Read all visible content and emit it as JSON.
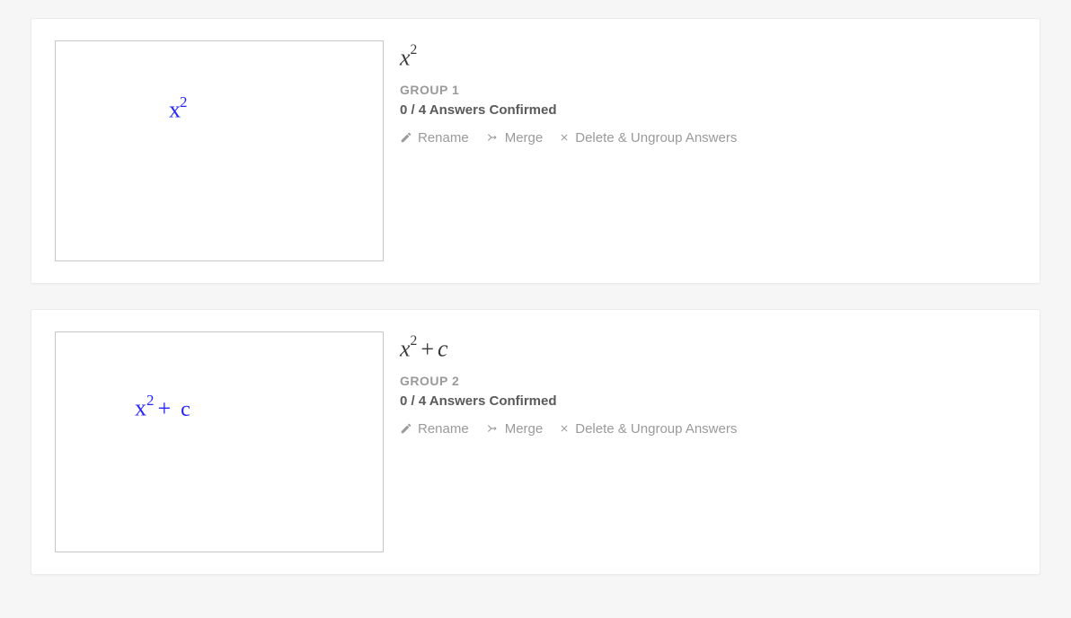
{
  "groups": [
    {
      "formula_html": "<i>x</i><sup>2</sup>",
      "group_label": "GROUP 1",
      "confirmed_text": "0 / 4 Answers Confirmed",
      "handwriting_html": "x<sup>2</sup>",
      "handwriting_class": "hw1"
    },
    {
      "formula_html": "<i>x</i><sup>2</sup><span class=\"op\">+</span><i>c</i>",
      "group_label": "GROUP 2",
      "confirmed_text": "0 / 4 Answers Confirmed",
      "handwriting_html": "x<sup>2</sup><span class=\"plus\">+</span><span class=\"c\">c</span>",
      "handwriting_class": "hw2"
    }
  ],
  "actions": {
    "rename": "Rename",
    "merge": "Merge",
    "delete": "Delete & Ungroup Answers"
  }
}
